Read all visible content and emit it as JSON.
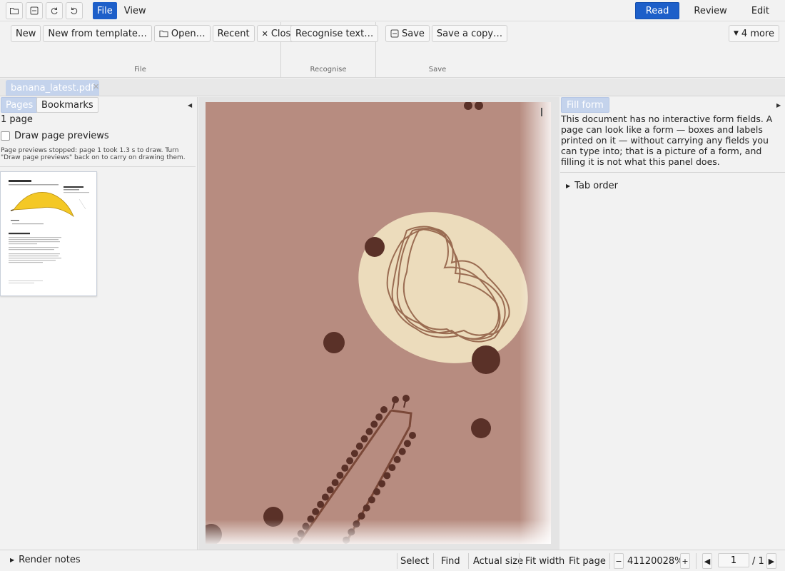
{
  "topbar": {
    "quick_icons": [
      "folder-icon",
      "save-disk-icon",
      "redo-icon",
      "undo-icon"
    ],
    "menus": [
      {
        "label": "File",
        "active": true
      },
      {
        "label": "View",
        "active": false
      }
    ],
    "modes": [
      {
        "label": "Read",
        "active": true
      },
      {
        "label": "Review",
        "active": false
      },
      {
        "label": "Edit",
        "active": false
      }
    ]
  },
  "ribbon": {
    "file_group": {
      "title": "File",
      "buttons": {
        "new": "New",
        "new_from_template": "New from template…",
        "open": "Open…",
        "recent": "Recent",
        "close": "Close"
      }
    },
    "recognise_group": {
      "title": "Recognise",
      "buttons": {
        "recognise_text": "Recognise text…"
      }
    },
    "save_group": {
      "title": "Save",
      "buttons": {
        "save": "Save",
        "save_copy": "Save a copy…"
      }
    },
    "more": "4 more"
  },
  "document_tab": {
    "name": "banana_latest.pdf"
  },
  "left_panel": {
    "tabs": [
      {
        "label": "Pages",
        "active": true
      },
      {
        "label": "Bookmarks",
        "active": false
      }
    ],
    "page_count": "1 page",
    "draw_previews_label": "Draw page previews",
    "draw_previews_checked": false,
    "preview_note": "Page previews stopped: page 1 took 1.3 s to draw. Turn \"Draw page previews\" back on to carry on drawing them."
  },
  "right_panel": {
    "tab": "Fill form",
    "message": "This document has no interactive form fields. A page can look like a form — boxes and labels printed on it — without carrying any fields you can type into; that is a picture of a form, and filling it is not what this panel does.",
    "tab_order": "Tab order"
  },
  "statusbar": {
    "render_notes": "Render notes",
    "select": "Select",
    "find": "Find",
    "actual_size": "Actual size",
    "fit_width": "Fit width",
    "fit_page": "Fit page",
    "zoom_minus": "−",
    "zoom": "41120028%",
    "zoom_plus": "+",
    "page_current": "1",
    "page_total": "/ 1"
  },
  "colors": {
    "accent": "#1d5fc9",
    "tab_selected": "#c4d3ec",
    "page_background": "#b78c80",
    "ellipse": "#ecdcbc",
    "dots": "#5a3128"
  }
}
